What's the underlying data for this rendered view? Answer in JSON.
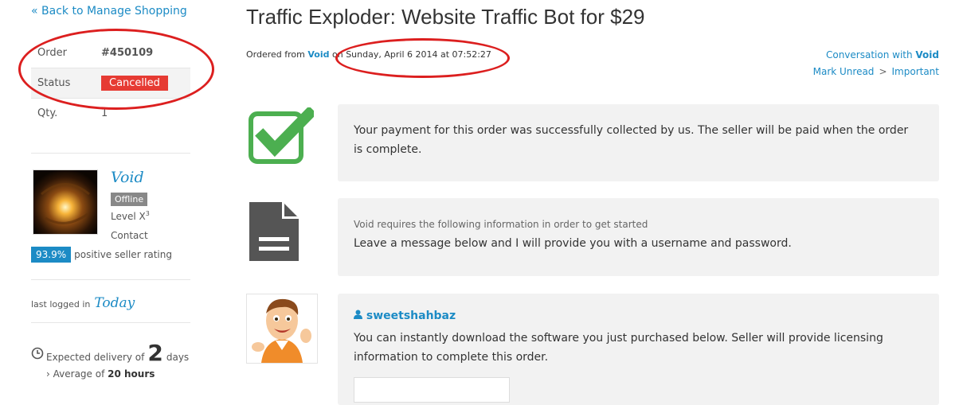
{
  "nav": {
    "back_label": "« Back to Manage Shopping"
  },
  "order": {
    "order_label": "Order",
    "order_value": "#450109",
    "status_label": "Status",
    "status_value": "Cancelled",
    "qty_label": "Qty.",
    "qty_value": "1"
  },
  "seller": {
    "name": "Void",
    "status": "Offline",
    "level_label": "Level X",
    "level_sup": "3",
    "contact": "Contact",
    "rating_pct": "93.9%",
    "rating_label": "positive seller rating"
  },
  "activity": {
    "last_logged_label": "last logged in",
    "last_logged_value": "Today"
  },
  "delivery": {
    "expected_label": "Expected delivery of",
    "days_value": "2",
    "days_label": "days",
    "average_label": "Average of",
    "average_value": "20 hours"
  },
  "header": {
    "title": "Traffic Exploder: Website Traffic Bot for $29",
    "ordered_from_prefix": "Ordered from",
    "ordered_from_seller": "Void",
    "ordered_from_mid": "on",
    "ordered_date": "Sunday, April 6 2014 at 07:52:27",
    "conversation_prefix": "Conversation with",
    "conversation_name": "Void",
    "mark_unread": "Mark Unread",
    "separator": ">",
    "important": "Important"
  },
  "messages": {
    "payment_text": "Your payment for this order was successfully collected by us. The seller will be paid when the order is complete.",
    "requirement_sub": "Void requires the following information in order to get started",
    "requirement_text": "Leave a message below and I will provide you with a username and password.",
    "user_name": "sweetshahbaz",
    "user_text": "You can instantly download the software you just purchased below. Seller will provide licensing information to complete this order."
  },
  "colors": {
    "accent": "#1c8bc5",
    "cancel": "#e63b33",
    "check": "#4caf50",
    "annotation": "#dc1f1f"
  }
}
